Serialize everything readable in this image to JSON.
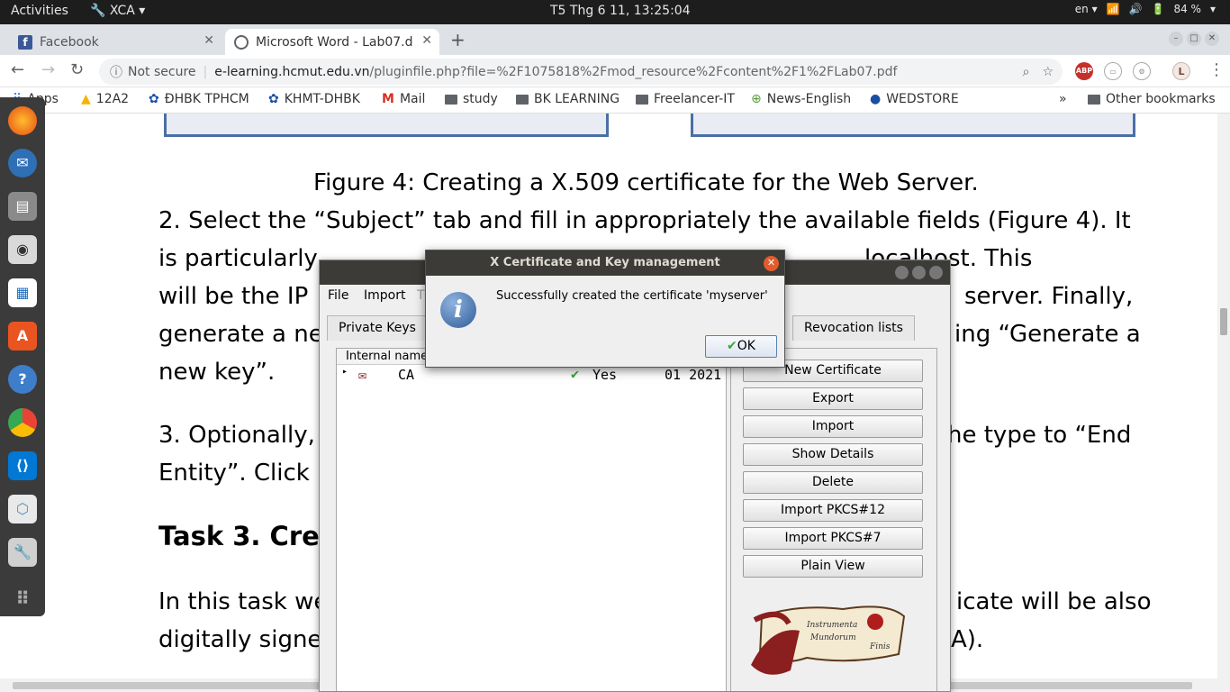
{
  "topbar": {
    "activities": "Activities",
    "app_name": "XCA",
    "datetime": "T5 Thg 6 11, 13:25:04",
    "lang": "en",
    "battery": "84 %"
  },
  "browser": {
    "tabs": [
      {
        "label": "Facebook"
      },
      {
        "label": "Microsoft Word - Lab07.d"
      }
    ],
    "address": {
      "security": "Not secure",
      "url_host": "e-learning.hcmut.edu.vn",
      "url_path": "/pluginfile.php?file=%2F1075818%2Fmod_resource%2Fcontent%2F1%2FLab07.pdf"
    },
    "profile_initial": "L",
    "bookmarks": [
      "Apps",
      "12A2",
      "ĐHBK TPHCM",
      "KHMT-DHBK",
      "Mail",
      "study",
      "BK LEARNING",
      "Freelancer-IT",
      "News-English",
      "WEDSTORE"
    ],
    "more_bookmarks": "»",
    "other_bookmarks": "Other bookmarks"
  },
  "document": {
    "caption": "Figure 4: Creating a X.509 certificate for the Web Server.",
    "p2_line1": "2. Select the “Subject” tab and fill in appropriately the available fields (Figure 4). It",
    "p2_line2a": "is particularly",
    "p2_line2b": "localhost. This",
    "p2_line3a": "will  be  the  IP",
    "p2_line3b": "server.  Finally,",
    "p2_line4a": "generate  a  ne",
    "p2_line4b": "ing  “Generate  a",
    "p2_line5": "new key”.",
    "p3_line1a": "3.  Optionally,",
    "p3_line1b": "he  type  to  “End",
    "p3_line2": "Entity”. Click",
    "task_heading": "Task 3. Crea",
    "p4_line1a": "In this task we",
    "p4_line1b": "icate will be also",
    "p4_line2a": "digitally signe",
    "p4_line2b": "A)."
  },
  "xca": {
    "menu": [
      "File",
      "Import",
      "T"
    ],
    "tabs": [
      "Private Keys",
      "Revocation lists"
    ],
    "list_header": "Internal name",
    "rows": [
      {
        "name": "CA",
        "trust": "Yes",
        "date": "01 2021"
      }
    ],
    "buttons": [
      "New Certificate",
      "Export",
      "Import",
      "Show Details",
      "Delete",
      "Import PKCS#12",
      "Import PKCS#7",
      "Plain View"
    ],
    "scroll_text": [
      "Instrumenta",
      "Mundorum",
      "Finis"
    ]
  },
  "dialog": {
    "title": "X Certificate and Key management",
    "message": "Successfully created the certificate 'myserver'",
    "ok": "OK"
  }
}
